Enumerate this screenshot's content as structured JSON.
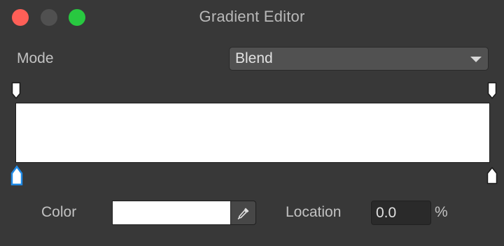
{
  "window": {
    "title": "Gradient Editor",
    "controls": [
      "close-button",
      "minimize-button",
      "zoom-button"
    ]
  },
  "mode": {
    "label": "Mode",
    "selected": "Blend"
  },
  "gradient": {
    "preview_color": "#ffffff",
    "alpha_stops": [
      {
        "location": 0.0,
        "selected": false
      },
      {
        "location": 100.0,
        "selected": false
      }
    ],
    "color_stops": [
      {
        "location": 0.0,
        "selected": true
      },
      {
        "location": 100.0,
        "selected": false
      }
    ]
  },
  "selected_stop": {
    "color_label": "Color",
    "color_value": "#ffffff",
    "location_label": "Location",
    "location_value": "0.0",
    "location_unit": "%"
  },
  "colors": {
    "background": "#383838",
    "close": "#fe5f57",
    "minimize": "#505050",
    "zoom": "#28c840",
    "selection_accent": "#1f8ae6"
  },
  "icons": {
    "eyedropper": "eyedropper-icon",
    "dropdown": "chevron-down-icon"
  }
}
